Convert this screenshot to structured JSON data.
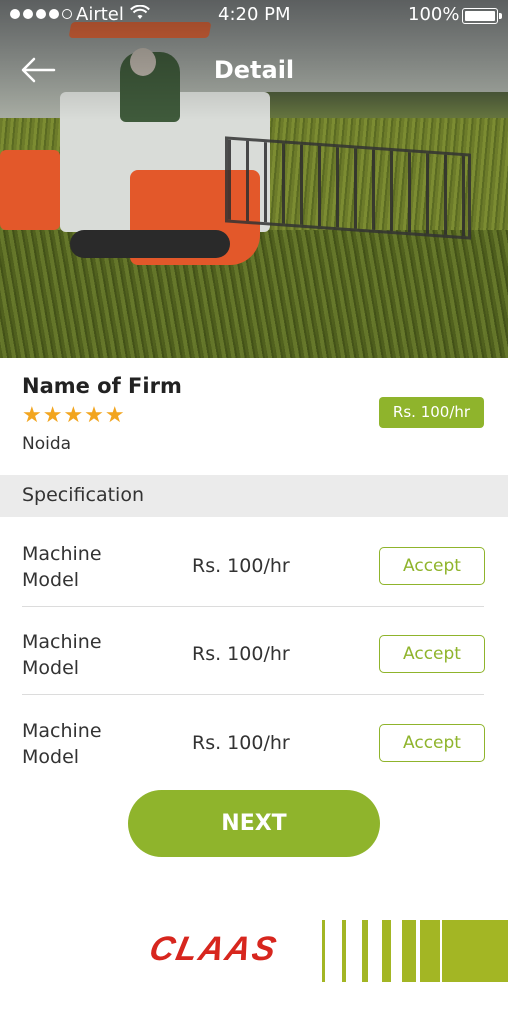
{
  "status_bar": {
    "carrier": "Airtel",
    "time": "4:20 PM",
    "battery": "100%"
  },
  "nav": {
    "title": "Detail",
    "back_icon": "back-arrow-icon"
  },
  "firm": {
    "name": "Name of Firm",
    "rating": 5,
    "stars": "★★★★★",
    "location": "Noida",
    "price": "Rs. 100/hr"
  },
  "specification": {
    "header": "Specification",
    "rows": [
      {
        "model": "Machine Model",
        "rate": "Rs. 100/hr",
        "action": "Accept"
      },
      {
        "model": "Machine Model",
        "rate": "Rs. 100/hr",
        "action": "Accept"
      },
      {
        "model": "Machine Model",
        "rate": "Rs. 100/hr",
        "action": "Accept"
      }
    ]
  },
  "next_button": "NEXT",
  "brand": {
    "logo": "CLAAS",
    "accent_color": "#8fb42c",
    "logo_color": "#d7261e"
  }
}
